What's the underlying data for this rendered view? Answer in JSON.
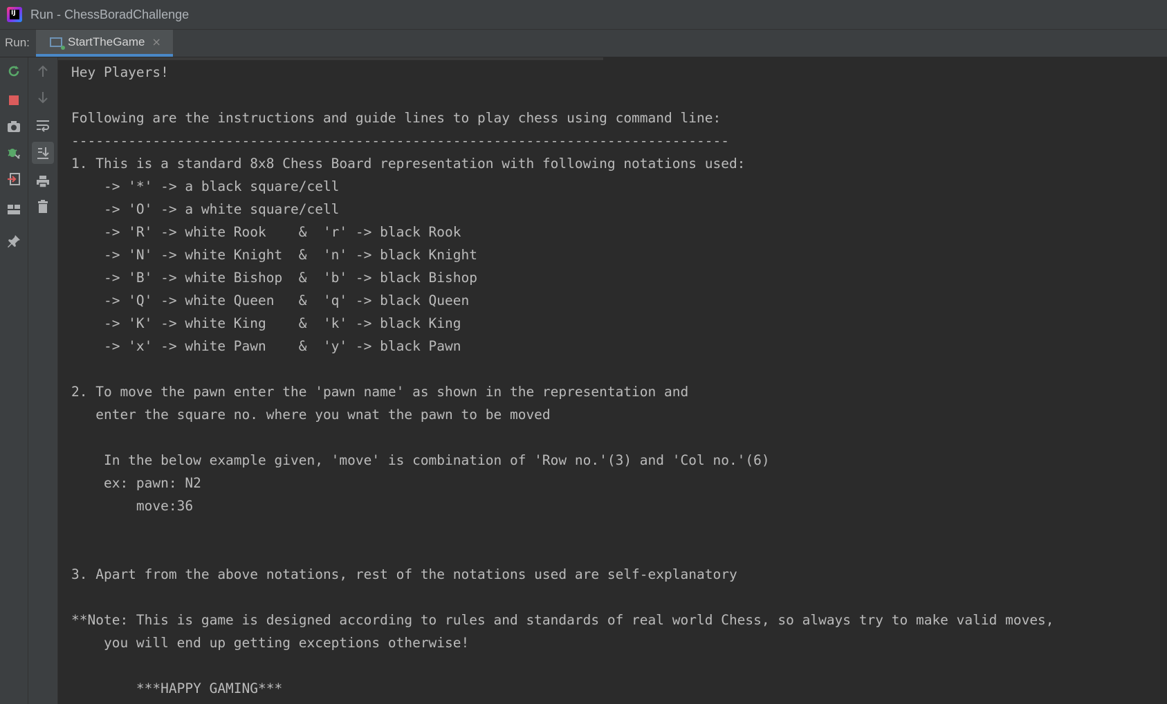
{
  "window": {
    "title": "Run - ChessBoradChallenge",
    "logo_text": "IJ"
  },
  "run_bar": {
    "label": "Run:",
    "tab_label": "StartTheGame",
    "tab_close": "×"
  },
  "left_toolbar": [
    "rerun-icon",
    "stop-icon",
    "camera-icon",
    "debug-icon",
    "login-icon",
    "layout-icon",
    "pin-icon"
  ],
  "console_toolbar": [
    "up-arrow-icon",
    "down-arrow-icon",
    "soft-wrap-icon",
    "scroll-to-end-icon",
    "print-icon",
    "trash-icon"
  ],
  "console": {
    "lines": [
      "Hey Players!",
      "",
      "Following are the instructions and guide lines to play chess using command line:",
      "---------------------------------------------------------------------------------",
      "1. This is a standard 8x8 Chess Board representation with following notations used:",
      "    -> '*' -> a black square/cell",
      "    -> 'O' -> a white square/cell",
      "    -> 'R' -> white Rook    &  'r' -> black Rook",
      "    -> 'N' -> white Knight  &  'n' -> black Knight",
      "    -> 'B' -> white Bishop  &  'b' -> black Bishop",
      "    -> 'Q' -> white Queen   &  'q' -> black Queen",
      "    -> 'K' -> white King    &  'k' -> black King",
      "    -> 'x' -> white Pawn    &  'y' -> black Pawn",
      "",
      "2. To move the pawn enter the 'pawn name' as shown in the representation and",
      "   enter the square no. where you wnat the pawn to be moved",
      "",
      "    In the below example given, 'move' is combination of 'Row no.'(3) and 'Col no.'(6)",
      "    ex: pawn: N2",
      "        move:36",
      "",
      "",
      "3. Apart from the above notations, rest of the notations used are self-explanatory",
      "",
      "**Note: This is game is designed according to rules and standards of real world Chess, so always try to make valid moves,",
      "    you will end up getting exceptions otherwise!",
      "",
      "        ***HAPPY GAMING***"
    ]
  }
}
